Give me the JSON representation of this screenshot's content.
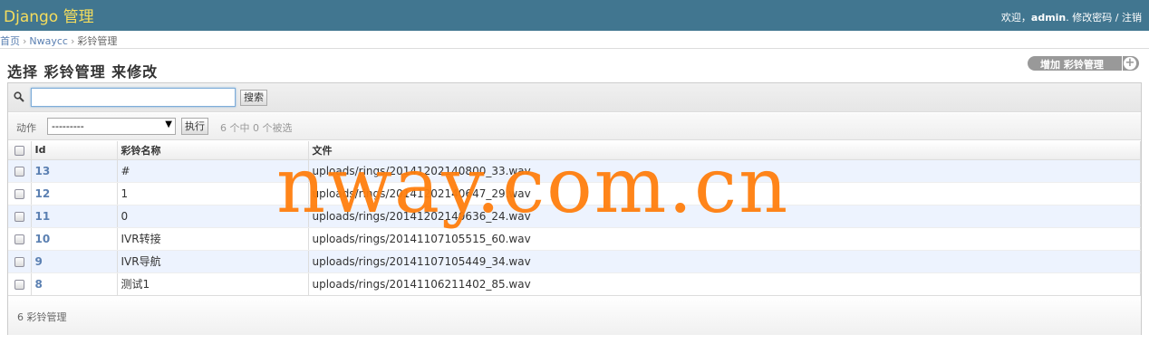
{
  "header": {
    "brand": "Django 管理",
    "welcome": "欢迎，",
    "username": "admin",
    "change_password": "修改密码",
    "separator": "/",
    "logout": "注销"
  },
  "breadcrumbs": {
    "home": "首页",
    "app": "Nwaycc",
    "current": "彩铃管理",
    "sep": "›"
  },
  "page_title": "选择 彩铃管理 来修改",
  "add_button": {
    "label": "增加 彩铃管理",
    "icon": "plus-icon"
  },
  "search": {
    "value": "",
    "button": "搜索",
    "icon": "search-icon"
  },
  "actions": {
    "label": "动作",
    "selected": "---------",
    "go": "执行",
    "count": "6 个中 0 个被选"
  },
  "table": {
    "columns": [
      "Id",
      "彩铃名称",
      "文件"
    ],
    "rows": [
      {
        "id": "13",
        "name": "#",
        "file": "uploads/rings/20141202140800_33.wav"
      },
      {
        "id": "12",
        "name": "1",
        "file": "uploads/rings/20141202140647_29.wav"
      },
      {
        "id": "11",
        "name": "0",
        "file": "uploads/rings/20141202140636_24.wav"
      },
      {
        "id": "10",
        "name": "IVR转接",
        "file": "uploads/rings/20141107105515_60.wav"
      },
      {
        "id": "9",
        "name": "IVR导航",
        "file": "uploads/rings/20141107105449_34.wav"
      },
      {
        "id": "8",
        "name": "测试1",
        "file": "uploads/rings/20141106211402_85.wav"
      }
    ]
  },
  "paginator": "6 彩铃管理",
  "watermark": "nway.com.cn",
  "colors": {
    "header_bg": "#417690",
    "brand": "#f5dd5d",
    "link": "#5b80b2",
    "alt_row": "#edf3fe",
    "watermark": "#ff7f0e"
  }
}
